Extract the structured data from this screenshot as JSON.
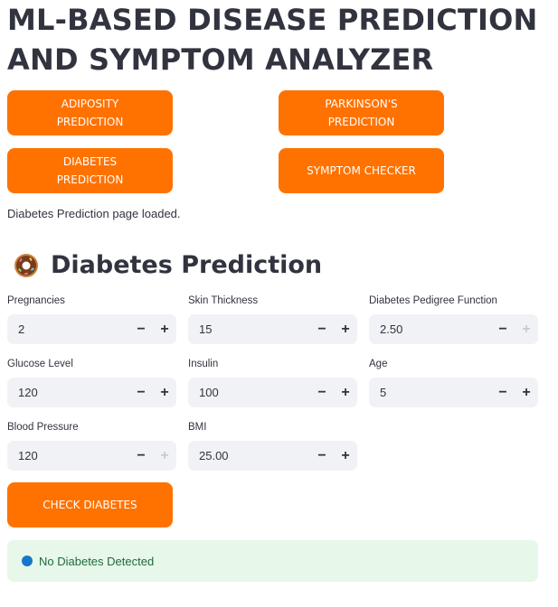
{
  "app": {
    "title_line1": "ML-BASED DISEASE PREDICTION",
    "title_line2": "AND SYMPTOM ANALYZER"
  },
  "nav": {
    "adiposity": "ADIPOSITY PREDICTION",
    "parkinsons": "PARKINSON'S PREDICTION",
    "diabetes": "DIABETES PREDICTION",
    "symptom": "SYMPTOM CHECKER"
  },
  "status_message": "Diabetes Prediction page loaded.",
  "section": {
    "title": "Diabetes Prediction",
    "icon": "donut-icon"
  },
  "fields": {
    "pregnancies": {
      "label": "Pregnancies",
      "value": "2"
    },
    "skin_thickness": {
      "label": "Skin Thickness",
      "value": "15"
    },
    "dpf": {
      "label": "Diabetes Pedigree Function",
      "value": "2.50"
    },
    "glucose": {
      "label": "Glucose Level",
      "value": "120"
    },
    "insulin": {
      "label": "Insulin",
      "value": "100"
    },
    "age": {
      "label": "Age",
      "value": "5"
    },
    "blood_pressure": {
      "label": "Blood Pressure",
      "value": "120"
    },
    "bmi": {
      "label": "BMI",
      "value": "25.00"
    }
  },
  "stepper": {
    "minus": "−",
    "plus": "+"
  },
  "check_button": "CHECK DIABETES",
  "result": {
    "text": "No Diabetes Detected",
    "dot_color": "#1778c9"
  },
  "colors": {
    "accent": "#ff7200",
    "input_bg": "#f0f2f6",
    "success_bg": "#e7f7ea"
  }
}
